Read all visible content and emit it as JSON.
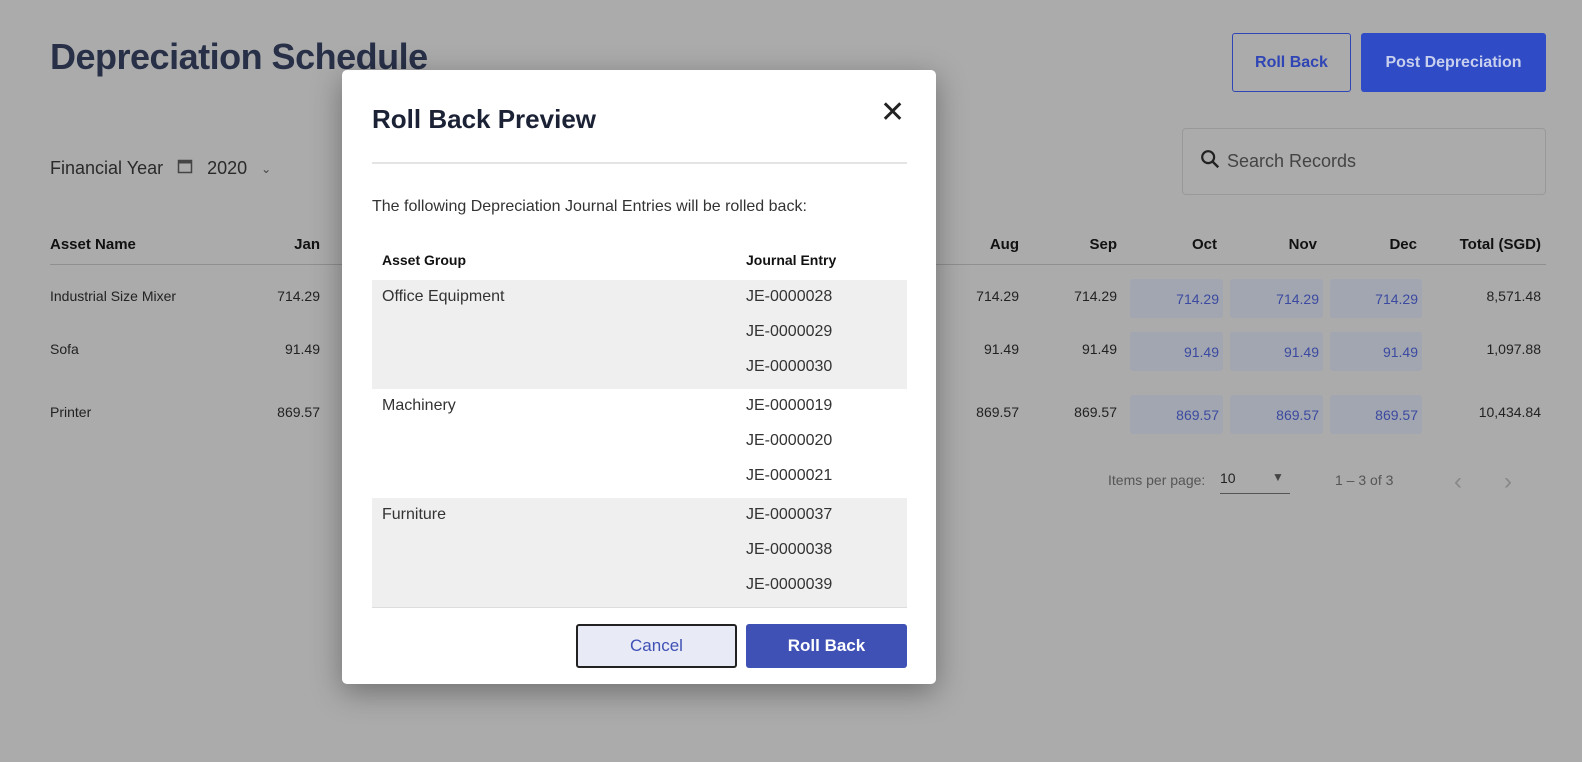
{
  "page": {
    "title": "Depreciation Schedule",
    "roll_back": "Roll Back",
    "post_depreciation": "Post Depreciation",
    "search_placeholder": "Search Records",
    "financial_year_label": "Financial Year",
    "financial_year": "2020"
  },
  "table": {
    "headers": {
      "asset": "Asset Name",
      "jan": "Jan",
      "aug": "Aug",
      "sep": "Sep",
      "oct": "Oct",
      "nov": "Nov",
      "dec": "Dec",
      "total": "Total (SGD)"
    },
    "rows": [
      {
        "asset": "Industrial Size Mixer",
        "jan": "714.29",
        "aug": "714.29",
        "sep": "714.29",
        "oct": "714.29",
        "nov": "714.29",
        "dec": "714.29",
        "total": "8,571.48"
      },
      {
        "asset": "Sofa",
        "jan": "91.49",
        "aug": "91.49",
        "sep": "91.49",
        "oct": "91.49",
        "nov": "91.49",
        "dec": "91.49",
        "total": "1,097.88"
      },
      {
        "asset": "Printer",
        "jan": "869.57",
        "aug": "869.57",
        "sep": "869.57",
        "oct": "869.57",
        "nov": "869.57",
        "dec": "869.57",
        "total": "10,434.84"
      }
    ]
  },
  "pagination": {
    "items_per_page_label": "Items per page:",
    "items_per_page": "10",
    "range": "1 – 3 of 3"
  },
  "modal": {
    "title": "Roll Back Preview",
    "description": "The following Depreciation Journal Entries will be rolled back:",
    "col_group": "Asset Group",
    "col_journal": "Journal Entry",
    "groups": [
      {
        "name": "Office Equipment",
        "entries": [
          "JE-0000028",
          "JE-0000029",
          "JE-0000030"
        ]
      },
      {
        "name": "Machinery",
        "entries": [
          "JE-0000019",
          "JE-0000020",
          "JE-0000021"
        ]
      },
      {
        "name": "Furniture",
        "entries": [
          "JE-0000037",
          "JE-0000038",
          "JE-0000039"
        ]
      }
    ],
    "cancel": "Cancel",
    "confirm": "Roll Back"
  },
  "colors": {
    "primary": "#3f51b5",
    "title": "#283048"
  }
}
